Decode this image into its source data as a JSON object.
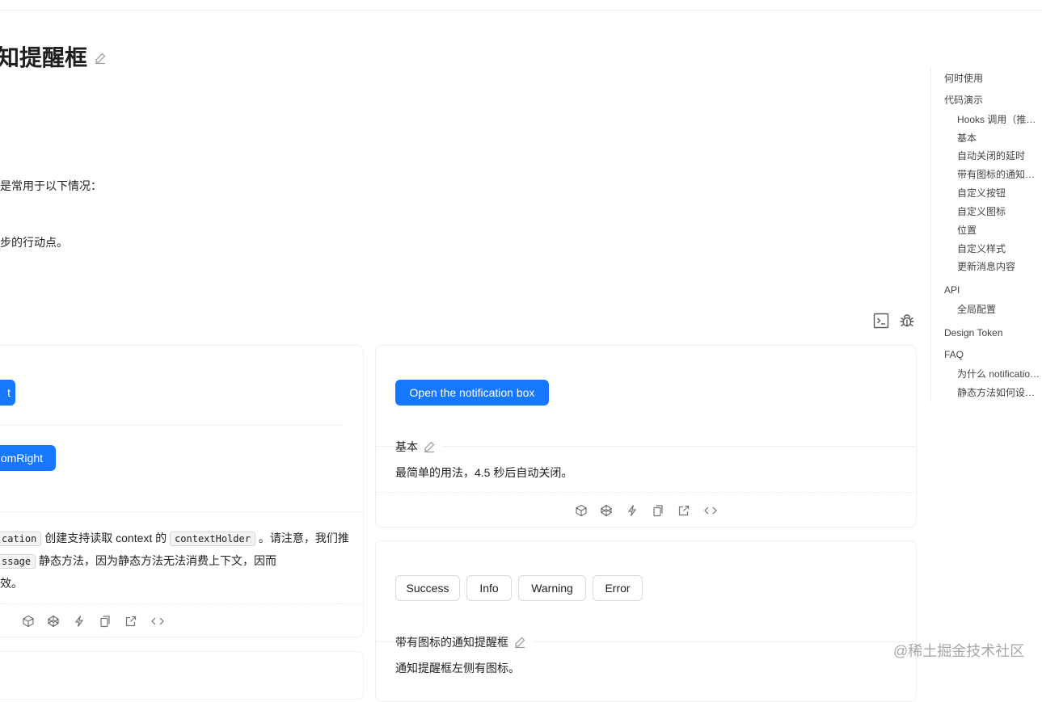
{
  "page": {
    "title": "知提醒框",
    "intro_line1": "是常用于以下情况：",
    "intro_line2": "步的行动点。"
  },
  "toc": {
    "items": [
      {
        "label": "何时使用",
        "level": 1
      },
      {
        "label": "代码演示",
        "level": 1
      },
      {
        "label": "Hooks 调用（推荐）",
        "level": 2
      },
      {
        "label": "基本",
        "level": 2
      },
      {
        "label": "自动关闭的延时",
        "level": 2
      },
      {
        "label": "带有图标的通知提醒框",
        "level": 2
      },
      {
        "label": "自定义按钮",
        "level": 2
      },
      {
        "label": "自定义图标",
        "level": 2
      },
      {
        "label": "位置",
        "level": 2
      },
      {
        "label": "自定义样式",
        "level": 2
      },
      {
        "label": "更新消息内容",
        "level": 2
      },
      {
        "label": "API",
        "level": 1
      },
      {
        "label": "全局配置",
        "level": 2
      },
      {
        "label": "Design Token",
        "level": 1
      },
      {
        "label": "FAQ",
        "level": 1
      },
      {
        "label": "为什么 notification 不能获取 context、redux 的内容和 ConfigProvider 的 locale/prefixCls/theme 等配置？",
        "level": 2
      },
      {
        "label": "静态方法如何设置 prefixCls？",
        "level": 2
      }
    ]
  },
  "hooks_demo": {
    "btn1_label": "t",
    "btn2_label": "omRight",
    "desc_code1": "cation",
    "desc_text1": " 创建支持读取 context 的 ",
    "desc_code2": "contextHolder",
    "desc_text2": " 。请注意，我们推",
    "desc_code3": "ssage",
    "desc_text3": " 静态方法，因为静态方法无法消费上下文，因而",
    "desc_text4": "效。"
  },
  "basic_demo": {
    "button_label": "Open the notification box",
    "section_title": "基本",
    "description": "最简单的用法，4.5 秒后自动关闭。"
  },
  "icon_demo": {
    "buttons": [
      "Success",
      "Info",
      "Warning",
      "Error"
    ],
    "section_title": "带有图标的通知提醒框",
    "description": "通知提醒框左侧有图标。"
  },
  "watermark": "@稀土掘金技术社区",
  "colors": {
    "primary": "#1677ff",
    "border": "#f0f0f0"
  }
}
